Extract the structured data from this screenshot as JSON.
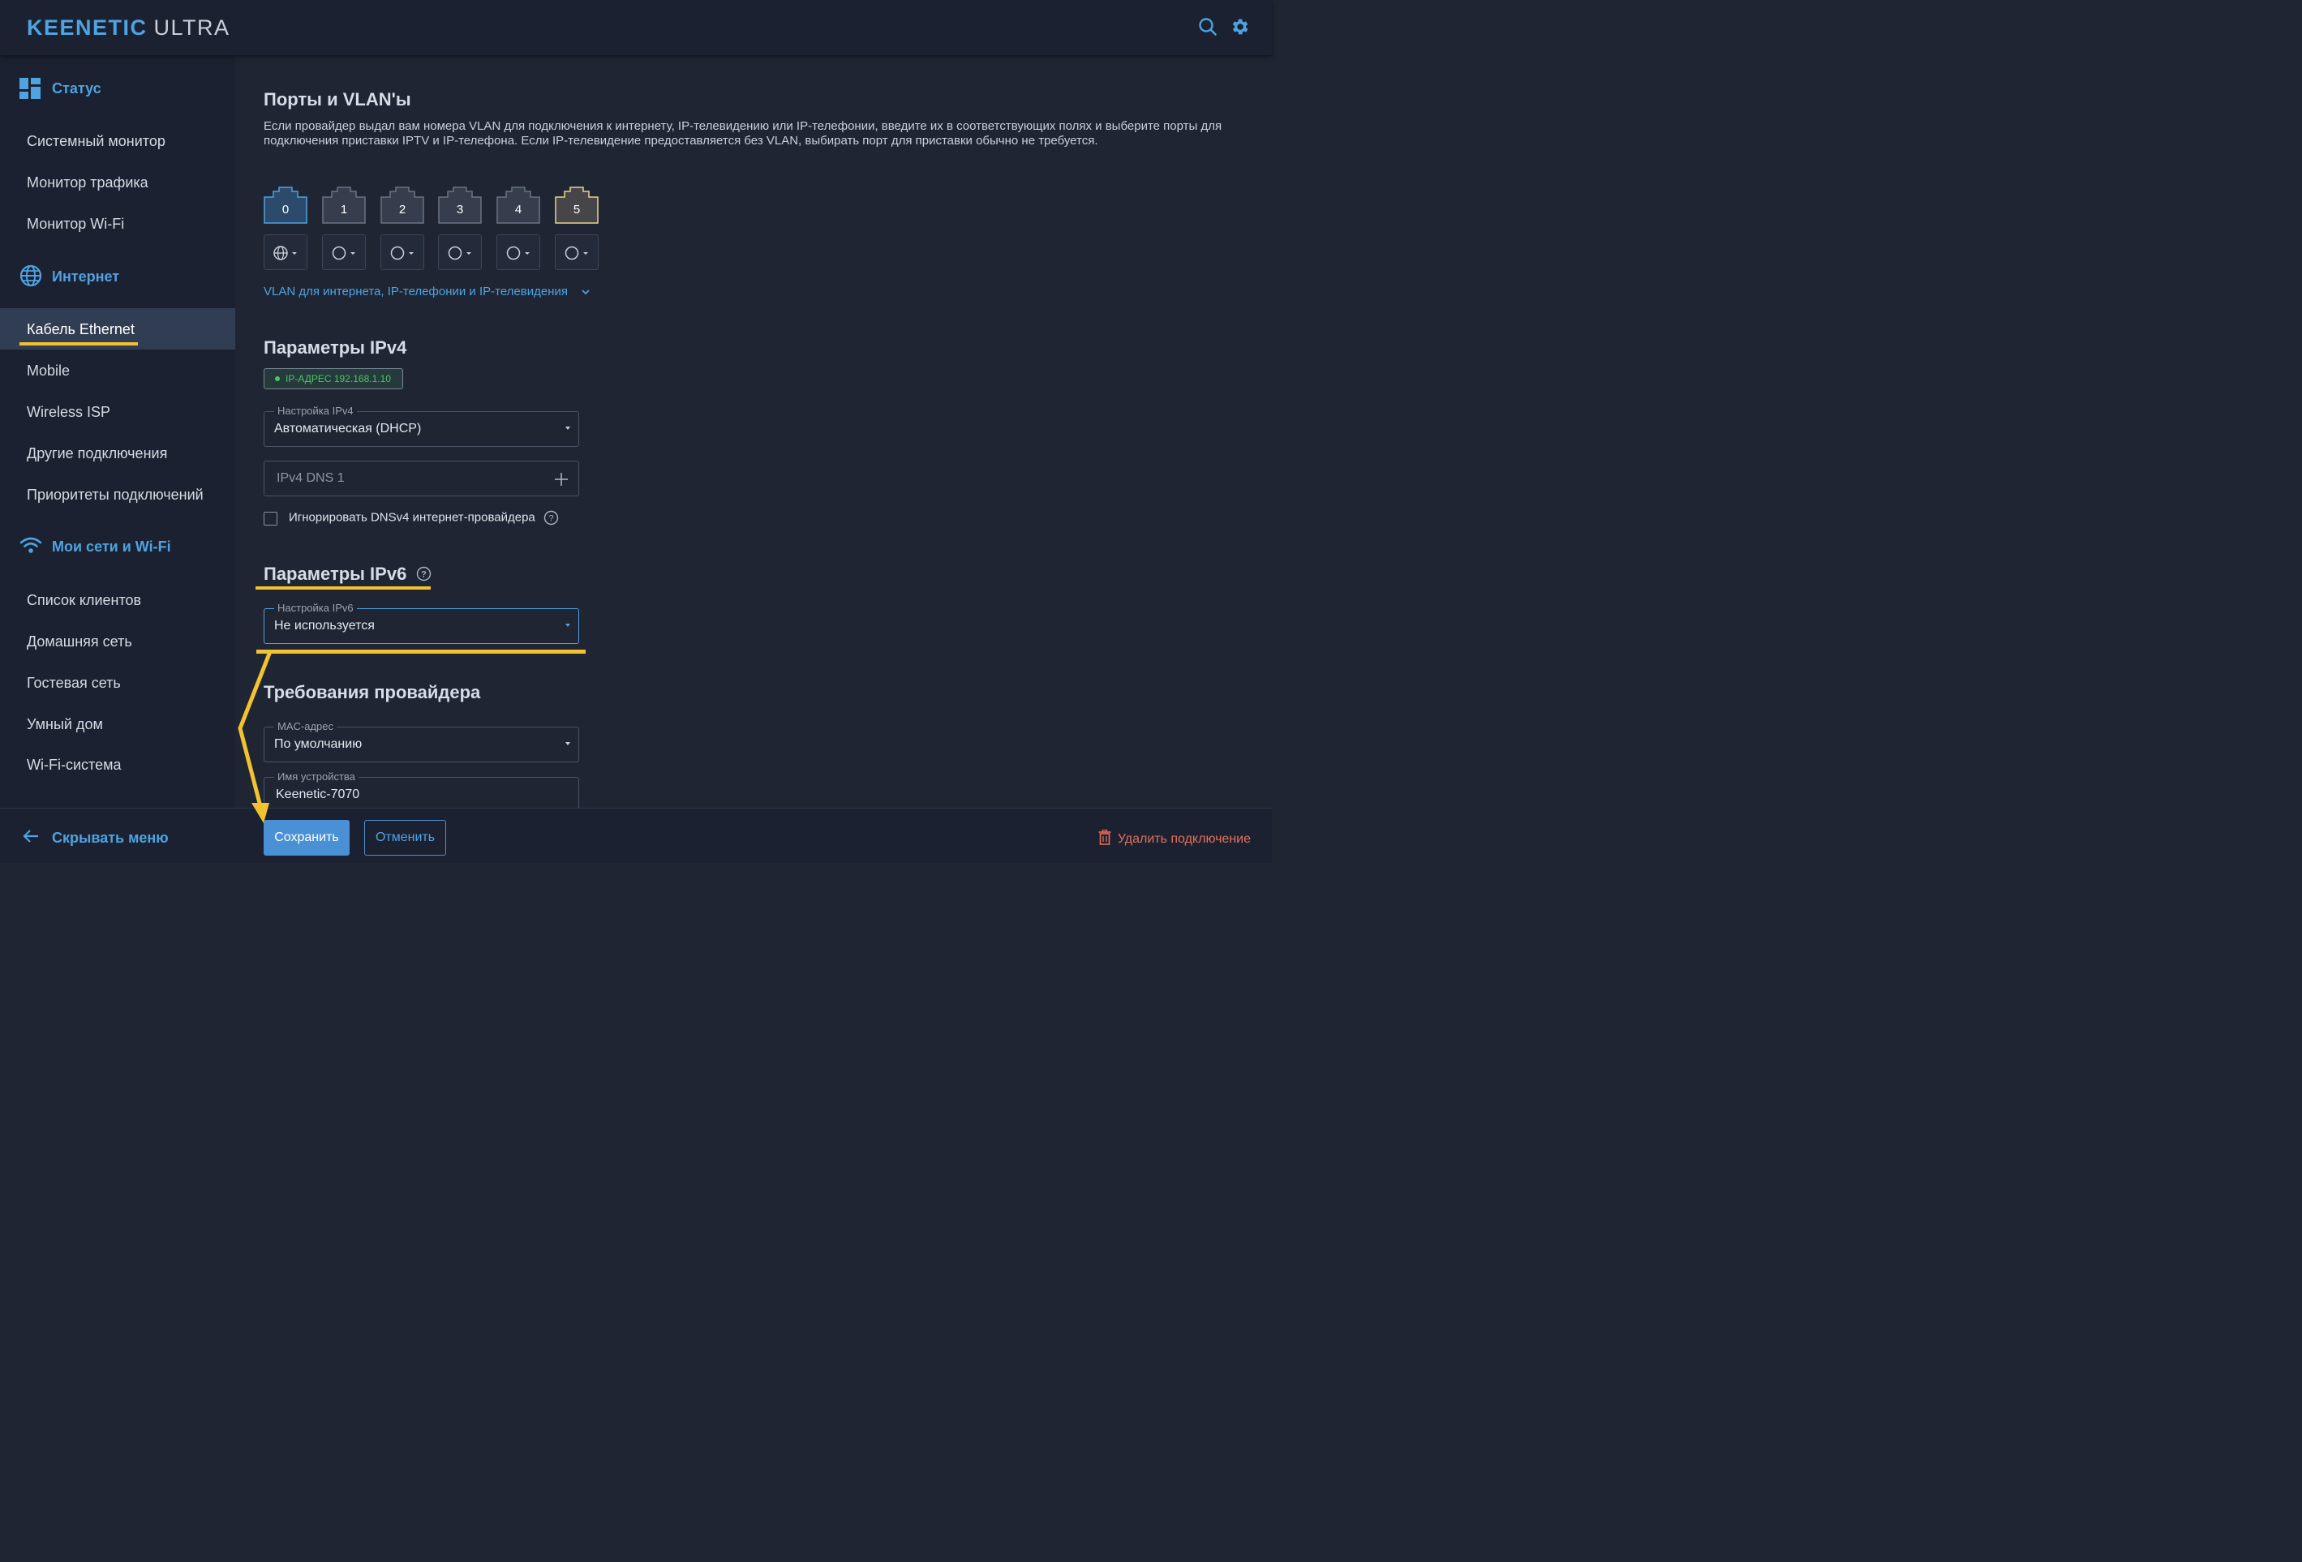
{
  "header": {
    "brand_primary": "KEENETIC",
    "brand_secondary": "ULTRA",
    "icons": [
      "search-icon",
      "gear-icon"
    ]
  },
  "sidebar": {
    "sections": [
      {
        "label": "Статус",
        "icon": "dashboard-icon",
        "items": [
          "Системный монитор",
          "Монитор трафика",
          "Монитор Wi-Fi"
        ]
      },
      {
        "label": "Интернет",
        "icon": "globe-icon",
        "items": [
          "Кабель Ethernet",
          "Mobile",
          "Wireless ISP",
          "Другие подключения",
          "Приоритеты подключений"
        ]
      },
      {
        "label": "Мои сети и Wi-Fi",
        "icon": "wifi-icon",
        "items": [
          "Список клиентов",
          "Домашняя сеть",
          "Гостевая сеть",
          "Умный дом",
          "Wi-Fi-система"
        ]
      }
    ],
    "active_item": "Кабель Ethernet",
    "hide_menu_label": "Скрывать меню"
  },
  "ports": {
    "title": "Порты и VLAN'ы",
    "description": "Если провайдер выдал вам номера VLAN для подключения к интернету, IP-телевидению или IP-телефонии, введите их в соответствующих полях и выберите порты для подключения приставки IPTV и IP-телефона. Если IP-телевидение предоставляется без VLAN, выбирать порт для приставки обычно не требуется.",
    "port_labels": [
      "0",
      "1",
      "2",
      "3",
      "4",
      "5"
    ],
    "port_modes": [
      "globe-icon",
      "circle-icon",
      "circle-icon",
      "circle-icon",
      "circle-icon",
      "circle-icon"
    ],
    "vlan_link": "VLAN для интернета, IP-телефонии и IP-телевидения"
  },
  "ipv4": {
    "title": "Параметры IPv4",
    "ip_badge": "IP-АДРЕС 192.168.1.10",
    "setting_label": "Настройка IPv4",
    "setting_value": "Автоматическая (DHCP)",
    "dns_placeholder": "IPv4 DNS 1",
    "ignore_dns_label": "Игнорировать DNSv4 интернет-провайдера",
    "ignore_dns_checked": false
  },
  "ipv6": {
    "title": "Параметры IPv6",
    "setting_label": "Настройка IPv6",
    "setting_value": "Не используется"
  },
  "provider": {
    "title": "Требования провайдера",
    "mac_label": "MAC-адрес",
    "mac_value": "По умолчанию",
    "device_name_label": "Имя устройства",
    "device_name_value": "Keenetic-7070"
  },
  "footer": {
    "save_label": "Сохранить",
    "cancel_label": "Отменить",
    "delete_label": "Удалить подключение"
  },
  "colors": {
    "accent": "#4ea3e0",
    "highlight": "#f2c230",
    "danger": "#e5705a",
    "success": "#4fc26a",
    "background": "#1f2533",
    "sidebar": "#1b2130"
  }
}
